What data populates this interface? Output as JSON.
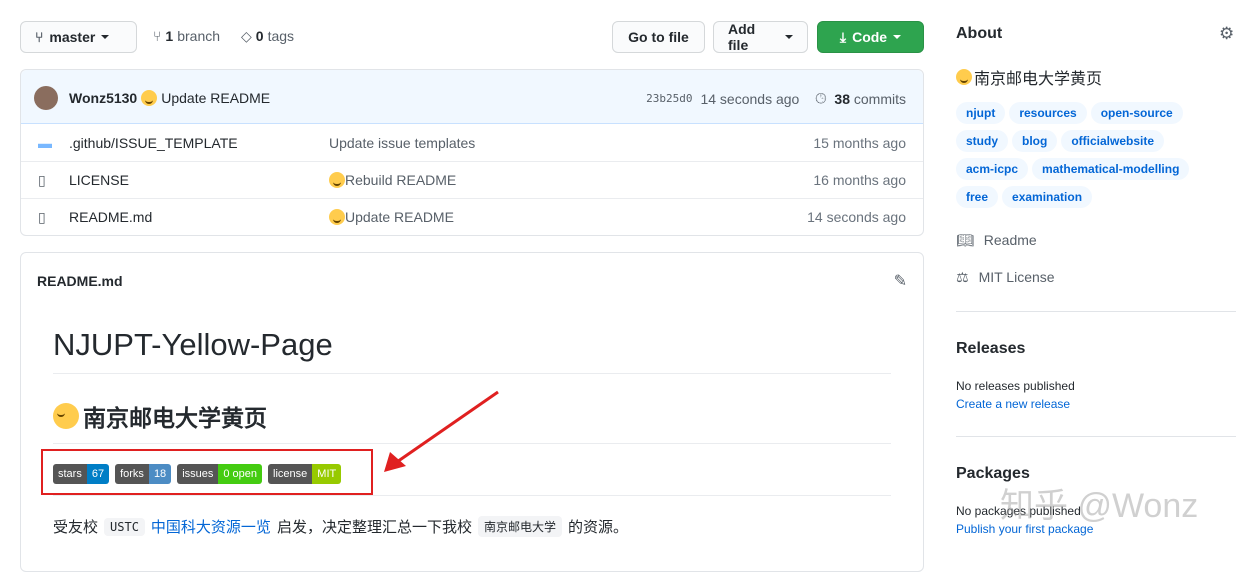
{
  "toolbar": {
    "branch": "master",
    "branch_count": "1",
    "branch_label": "branch",
    "tag_count": "0",
    "tag_label": "tags",
    "go_to_file": "Go to file",
    "add_file": "Add file",
    "code": "Code"
  },
  "commit": {
    "author": "Wonz5130",
    "message": "Update README",
    "sha": "23b25d0",
    "time": "14 seconds ago",
    "commit_count": "38",
    "commits_label": "commits"
  },
  "files": [
    {
      "name": ".github/ISSUE_TEMPLATE",
      "type": "folder",
      "message": "Update issue templates",
      "emoji": false,
      "age": "15 months ago"
    },
    {
      "name": "LICENSE",
      "type": "file",
      "message": "Rebuild README",
      "emoji": true,
      "age": "16 months ago"
    },
    {
      "name": "README.md",
      "type": "file",
      "message": "Update README",
      "emoji": true,
      "age": "14 seconds ago"
    }
  ],
  "readme": {
    "filename": "README.md",
    "title": "NJUPT-Yellow-Page",
    "subtitle": "南京邮电大学黄页",
    "badges": [
      {
        "label": "stars",
        "value": "67",
        "color": "#007ec6"
      },
      {
        "label": "forks",
        "value": "18",
        "color": "#4c8cc4"
      },
      {
        "label": "issues",
        "value": "0 open",
        "color": "#4c1"
      },
      {
        "label": "license",
        "value": "MIT",
        "color": "#97ca00"
      }
    ],
    "intro": {
      "p1": "受友校",
      "code1": "USTC",
      "link": "中国科大资源一览",
      "p2": "启发，决定整理汇总一下我校",
      "code2": "南京邮电大学",
      "p3": "的资源。"
    }
  },
  "about": {
    "heading": "About",
    "description": "南京邮电大学黄页",
    "topics": [
      "njupt",
      "resources",
      "open-source",
      "study",
      "blog",
      "officialwebsite",
      "acm-icpc",
      "mathematical-modelling",
      "free",
      "examination"
    ],
    "readme": "Readme",
    "license": "MIT License"
  },
  "releases": {
    "heading": "Releases",
    "empty": "No releases published",
    "link": "Create a new release"
  },
  "packages": {
    "heading": "Packages",
    "empty": "No packages published",
    "link": "Publish your first package"
  },
  "watermark": "知乎 @Wonz",
  "colors": {
    "accent": "#0366d6",
    "code_button": "#2ea44f",
    "annotation": "#e02020"
  }
}
